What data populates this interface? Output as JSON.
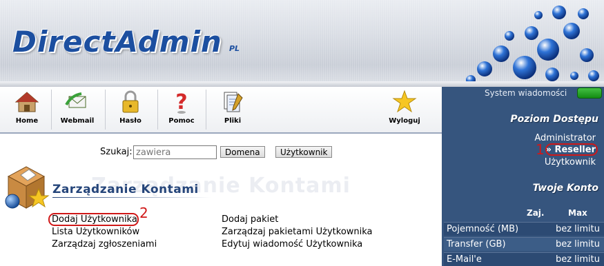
{
  "header": {
    "logo_text": "DirectAdmin",
    "logo_suffix": "PL"
  },
  "toolbar": {
    "items": [
      {
        "label": "Home",
        "icon": "home-icon"
      },
      {
        "label": "Webmail",
        "icon": "webmail-icon"
      },
      {
        "label": "Hasło",
        "icon": "lock-icon"
      },
      {
        "label": "Pomoc",
        "icon": "help-icon"
      },
      {
        "label": "Pliki",
        "icon": "files-icon"
      },
      {
        "label": "Wyloguj",
        "icon": "star-icon"
      }
    ]
  },
  "system_messages": {
    "label": "System wiadomości",
    "status_color": "#2aa82a"
  },
  "access_level": {
    "title": "Poziom Dostępu",
    "items": [
      "Administrator",
      "» Reseller",
      "Użytkownik"
    ],
    "active": "» Reseller"
  },
  "account": {
    "title": "Twoje Konto",
    "columns": [
      "Zaj.",
      "Max"
    ],
    "rows": [
      {
        "label": "Pojemność (MB)",
        "max": "bez limitu"
      },
      {
        "label": "Transfer (GB)",
        "max": "bez limitu"
      },
      {
        "label": "E-Mail'e",
        "max": "bez limitu"
      }
    ]
  },
  "search": {
    "label": "Szukaj:",
    "placeholder": "zawiera",
    "buttons": [
      "Domena",
      "Użytkownik"
    ]
  },
  "section": {
    "title": "Zarządzanie Kontami",
    "links_left": [
      "Dodaj Użytkownika",
      "Lista Użytkowników",
      "Zarządzaj zgłoszeniami"
    ],
    "links_right": [
      "Dodaj pakiet",
      "Zarządzaj pakietami Użytkownika",
      "Edytuj wiadomość Użytkownika"
    ]
  },
  "annotations": [
    "1",
    "2"
  ],
  "colors": {
    "accent": "#1c4fa0",
    "panel": "#36557e",
    "highlight": "#d01818"
  }
}
